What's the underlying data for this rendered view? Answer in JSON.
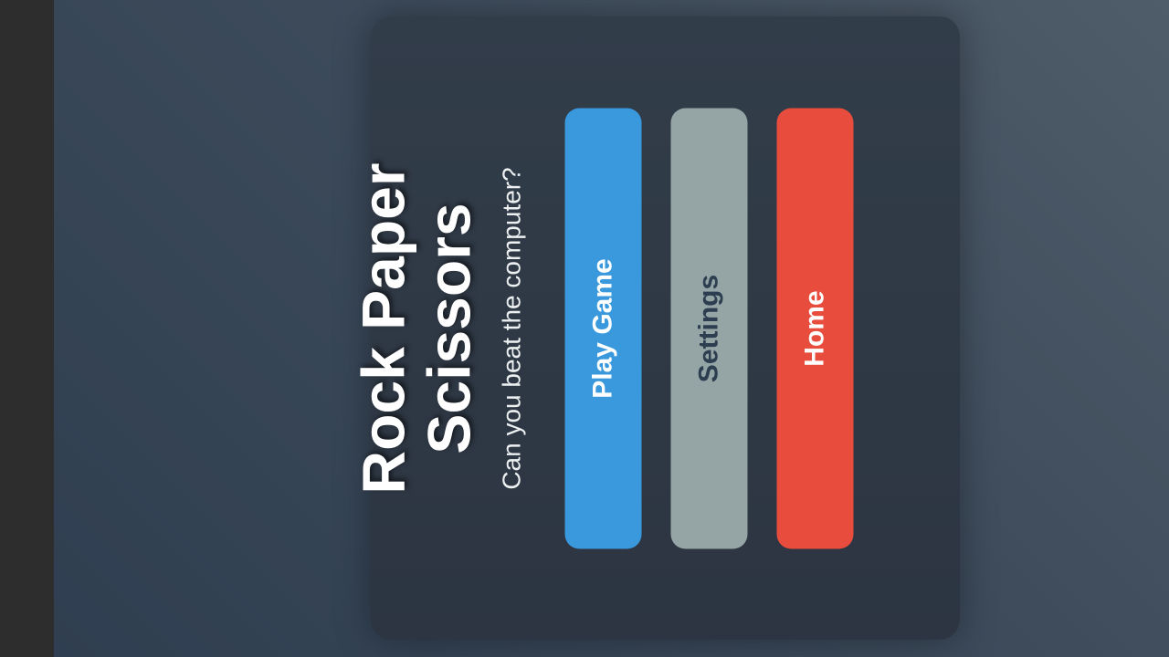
{
  "menu": {
    "title_line1": "Rock Paper",
    "title_line2": "Scissors",
    "subtitle": "Can you beat the computer?",
    "buttons": {
      "play": "Play Game",
      "settings": "Settings",
      "home": "Home"
    }
  },
  "colors": {
    "play": "#3a99dc",
    "settings": "#95a5a6",
    "home": "#e74c3c",
    "card": "#2f3945"
  }
}
